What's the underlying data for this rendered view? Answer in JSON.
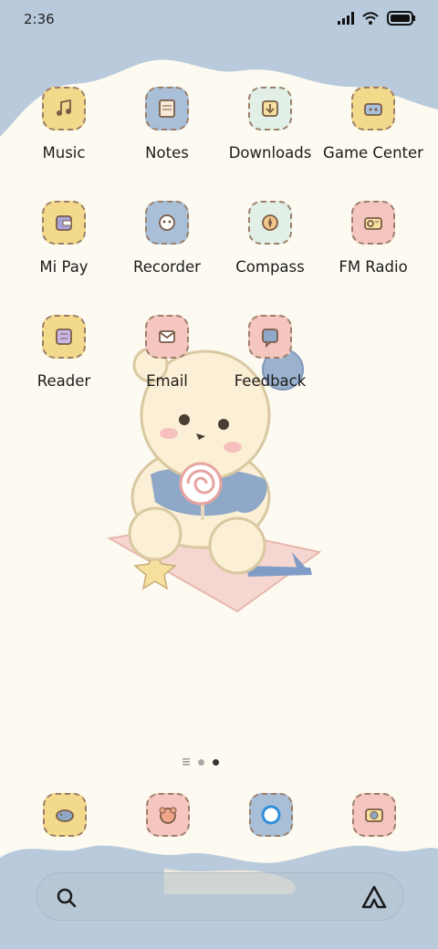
{
  "status_bar": {
    "time": "2:36",
    "icons": [
      "signal-icon",
      "wifi-icon",
      "battery-icon"
    ]
  },
  "apps": [
    {
      "label": "Music",
      "icon": "music-note-icon",
      "color": "#f3d98b"
    },
    {
      "label": "Notes",
      "icon": "notes-icon",
      "color": "#a9bfd8"
    },
    {
      "label": "Downloads",
      "icon": "download-icon",
      "color": "#e2efe6"
    },
    {
      "label": "Game Center",
      "icon": "game-controller-icon",
      "color": "#f3d98b"
    },
    {
      "label": "Mi Pay",
      "icon": "wallet-icon",
      "color": "#f3d98b"
    },
    {
      "label": "Recorder",
      "icon": "microphone-icon",
      "color": "#a9bfd8"
    },
    {
      "label": "Compass",
      "icon": "compass-icon",
      "color": "#e2efe6"
    },
    {
      "label": "FM Radio",
      "icon": "radio-icon",
      "color": "#f5c6bf"
    },
    {
      "label": "Reader",
      "icon": "book-icon",
      "color": "#f3d98b"
    },
    {
      "label": "Email",
      "icon": "mail-icon",
      "color": "#f5c6bf"
    },
    {
      "label": "Feedback",
      "icon": "feedback-icon",
      "color": "#f5c6bf"
    }
  ],
  "page_indicator": {
    "pages": 2,
    "active": 2
  },
  "dock": [
    {
      "name": "dock-app-1",
      "icon": "whale-icon",
      "color": "#f3d98b"
    },
    {
      "name": "dock-app-2",
      "icon": "bear-face-icon",
      "color": "#f5c6bf"
    },
    {
      "name": "dock-app-3",
      "icon": "browser-circle-icon",
      "color": "#a9bfd8"
    },
    {
      "name": "dock-app-4",
      "icon": "camera-icon",
      "color": "#f5c6bf"
    }
  ],
  "search_bar": {
    "search_icon": "search-icon",
    "assistant_icon": "assistant-icon"
  },
  "theme": {
    "background": "#fdfbf1",
    "accent_blue": "#b7c9dd"
  }
}
